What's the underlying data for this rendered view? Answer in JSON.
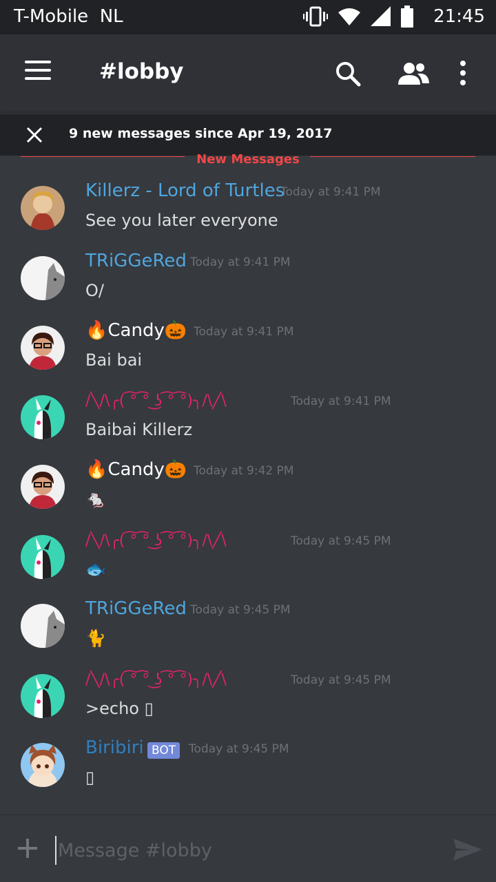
{
  "status_bar": {
    "carrier": "T-Mobile  NL",
    "time": "21:45"
  },
  "header": {
    "channel": "#lobby"
  },
  "banner": {
    "text": "9 new messages since Apr 19, 2017"
  },
  "divider": {
    "label": "New Messages"
  },
  "colors": {
    "accent": "#7289da",
    "link": "#4fa6de",
    "danger": "#f04747",
    "pink": "#e0236c"
  },
  "messages": [
    {
      "name": "Killerz - Lord of Turtles",
      "time": "Today at 9:41 PM",
      "text": "See you later everyone"
    },
    {
      "name": "TRiGGeRed",
      "time": "Today at 9:41 PM",
      "text": "O/"
    },
    {
      "name": "🔥Candy🎃",
      "time": "Today at 9:41 PM",
      "text": "Bai bai"
    },
    {
      "name": "/╲/\\╭( ͡° ͡° ͜ʖ ͡° ͡°)╮/\\╱\\",
      "time": "Today at 9:41 PM",
      "text": "Baibai Killerz"
    },
    {
      "name": "🔥Candy🎃",
      "time": "Today at 9:42 PM",
      "text": "🐁"
    },
    {
      "name": "/╲/\\╭( ͡° ͡° ͜ʖ ͡° ͡°)╮/\\╱\\",
      "time": "Today at 9:45 PM",
      "text": "🐟"
    },
    {
      "name": "TRiGGeRed",
      "time": "Today at 9:45 PM",
      "text": "🐈"
    },
    {
      "name": "/╲/\\╭( ͡° ͡° ͜ʖ ͡° ͡°)╮/\\╱\\",
      "time": "Today at 9:45 PM",
      "text": ">echo ▯"
    },
    {
      "name": "Biribiri",
      "badge": "BOT",
      "time": "Today at 9:45 PM",
      "text": "▯"
    }
  ],
  "composer": {
    "placeholder": "Message #lobby"
  }
}
